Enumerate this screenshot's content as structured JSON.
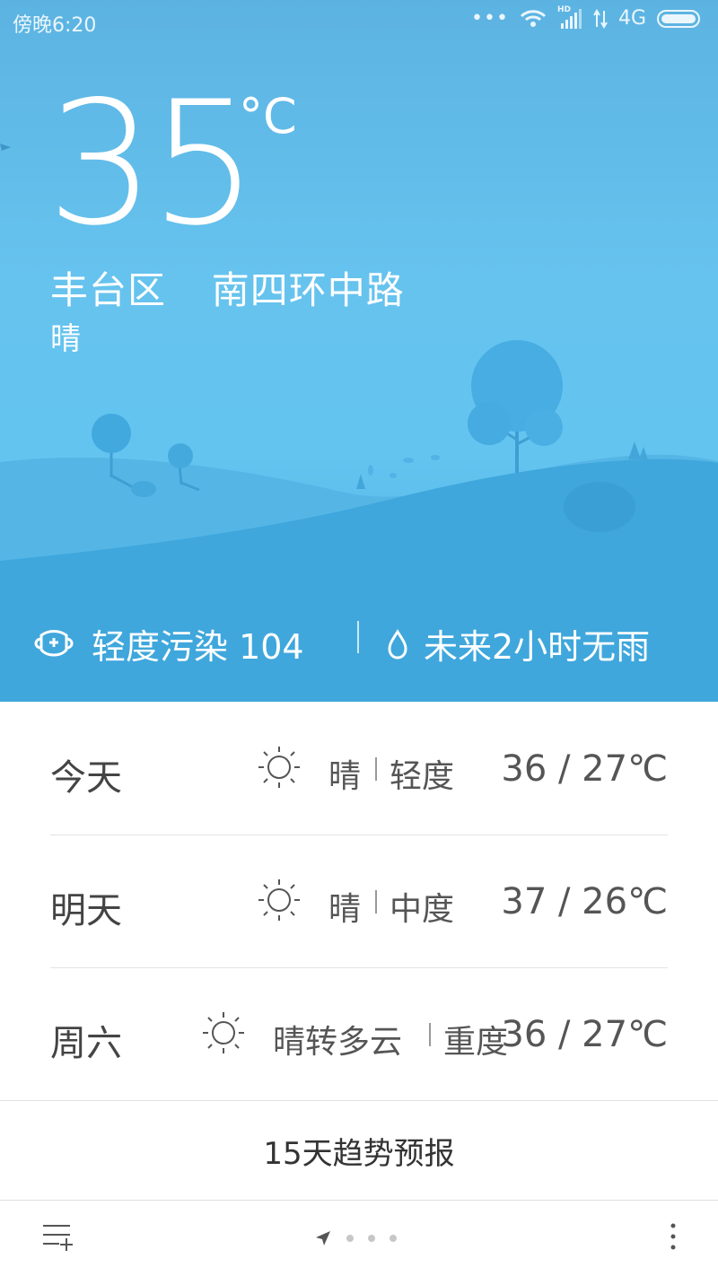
{
  "status_bar": {
    "time": "傍晚6:20",
    "network": "4G",
    "hd_label": "HD",
    "icons": [
      "more-dots-icon",
      "wifi-icon",
      "signal-icon",
      "data-arrows-icon",
      "battery-icon"
    ]
  },
  "current": {
    "temperature": "35",
    "unit": "°C",
    "district": "丰台区",
    "street": "南四环中路",
    "condition": "晴"
  },
  "info_bar": {
    "air_quality": "轻度污染 104",
    "rain_forecast": "未来2小时无雨",
    "icons": [
      "mask-icon",
      "water-drop-icon"
    ]
  },
  "forecast": [
    {
      "day": "今天",
      "condition": "晴",
      "aqi": "轻度",
      "range": "36 / 27℃",
      "icon": "sun-icon"
    },
    {
      "day": "明天",
      "condition": "晴",
      "aqi": "中度",
      "range": "37 / 26℃",
      "icon": "sun-icon"
    },
    {
      "day": "周六",
      "condition": "晴转多云",
      "aqi": "重度",
      "range": "36 / 27℃",
      "icon": "sun-icon"
    }
  ],
  "trend_button": "15天趋势预报",
  "bottom_bar": {
    "icons": [
      "city-list-icon",
      "location-arrow-icon",
      "more-vertical-icon"
    ],
    "page_count": 4,
    "current_page": 1
  },
  "colors": {
    "sky_top": "#5cb3e2",
    "sky_mid": "#66c3ee",
    "hill": "#3ea8dc",
    "text_dark": "#444444"
  }
}
